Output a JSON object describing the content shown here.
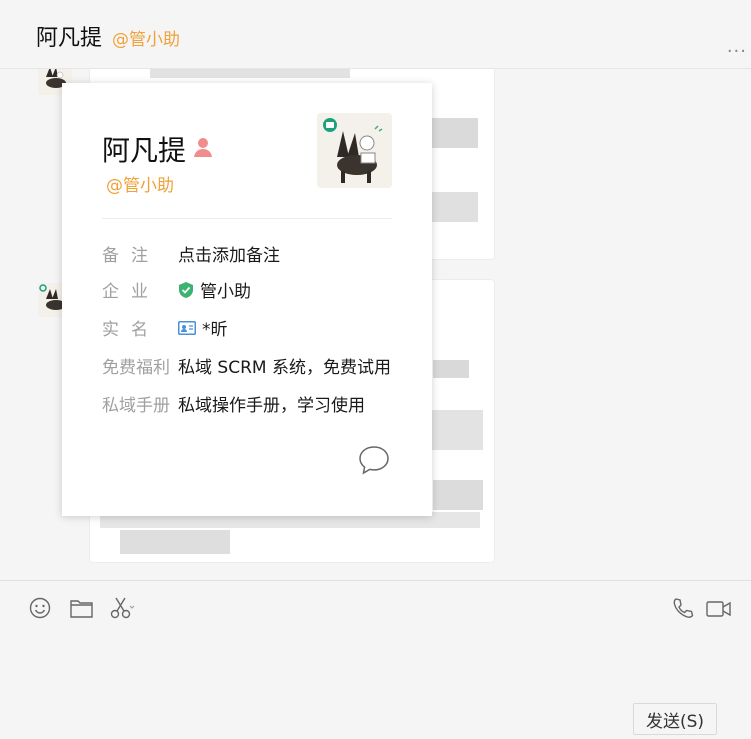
{
  "header": {
    "name": "阿凡提",
    "corp": "@管小助",
    "more": "..."
  },
  "card": {
    "name": "阿凡提",
    "corp": "@管小助",
    "rows": [
      {
        "label": "备注",
        "value": "点击添加备注"
      },
      {
        "label": "企业",
        "value": "管小助"
      },
      {
        "label": "实名",
        "value": "*昕"
      },
      {
        "label": "免费福利",
        "value": "私域 SCRM 系统，免费试用"
      },
      {
        "label": "私域手册",
        "value": "私域操作手册，学习使用"
      }
    ]
  },
  "toolbar": {
    "send_label": "发送(S)"
  },
  "colors": {
    "accent": "#f0a13a",
    "verified": "#3cb371",
    "user_icon": "#f08c8c"
  }
}
